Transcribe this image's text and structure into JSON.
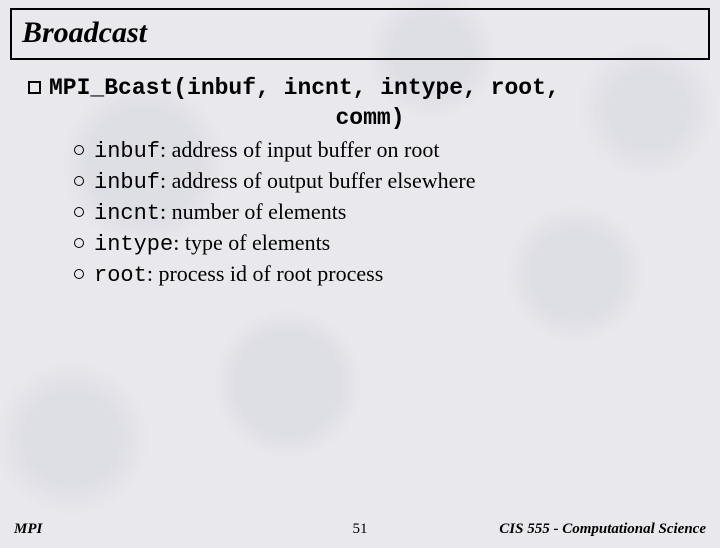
{
  "title": "Broadcast",
  "signature_line1": "MPI_Bcast(inbuf, incnt, intype, root,",
  "signature_line2": "comm)",
  "params": [
    {
      "name": "inbuf",
      "sep": ": ",
      "desc": "address of input buffer on root"
    },
    {
      "name": "inbuf",
      "sep": ": ",
      "desc": "address of output buffer elsewhere"
    },
    {
      "name": "incnt",
      "sep": ": ",
      "desc": "number of elements"
    },
    {
      "name": "intype",
      "sep": ": ",
      "desc": "type of elements"
    },
    {
      "name": "root",
      "sep": ": ",
      "desc": "process id of root process"
    }
  ],
  "footer": {
    "left": "MPI",
    "center": "51",
    "right": "CIS 555 - Computational Science"
  }
}
